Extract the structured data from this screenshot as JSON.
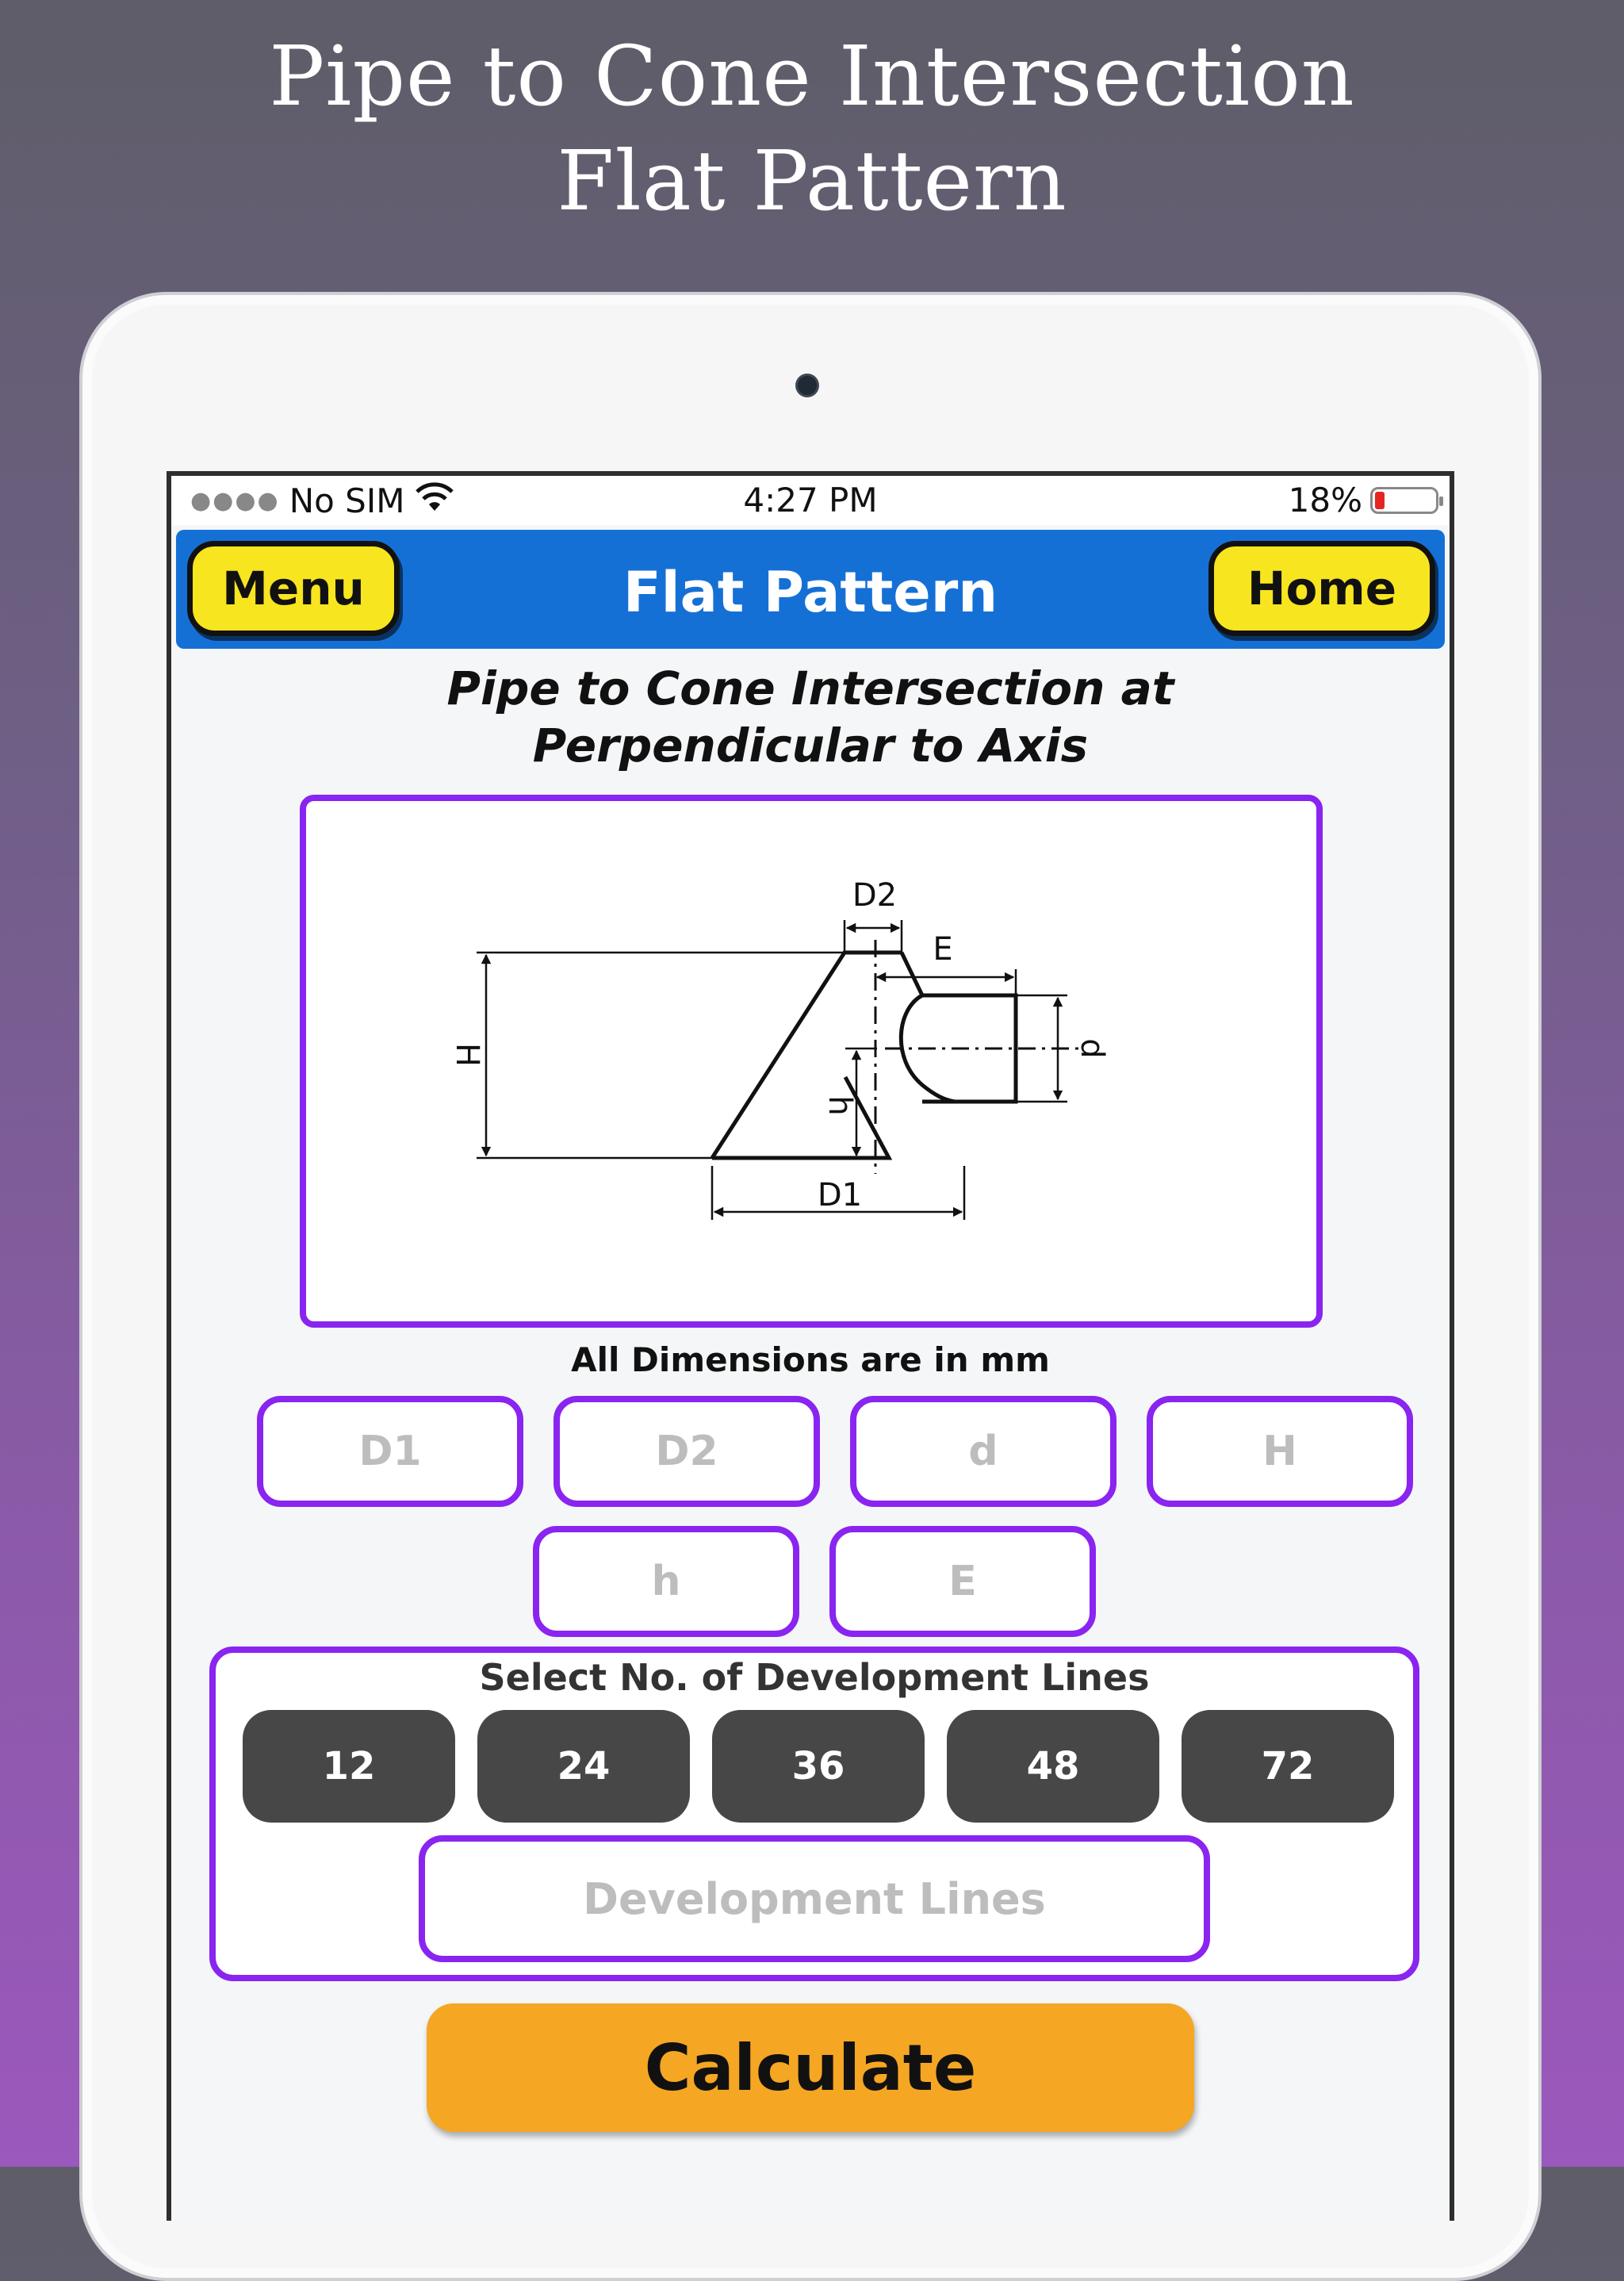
{
  "headline": {
    "line1": "Pipe to Cone Intersection",
    "line2": "Flat Pattern"
  },
  "status_bar": {
    "carrier": "No SIM",
    "time": "4:27 PM",
    "battery": "18%"
  },
  "nav": {
    "title": "Flat Pattern",
    "menu_label": "Menu",
    "home_label": "Home"
  },
  "page": {
    "title_line1": "Pipe to Cone Intersection at",
    "title_line2": "Perpendicular to Axis",
    "units_note": "All Dimensions are in mm"
  },
  "diagram": {
    "labels": {
      "D1": "D1",
      "D2": "D2",
      "E": "E",
      "H": "H",
      "h": "h",
      "d": "d"
    }
  },
  "inputs": {
    "D1": "D1",
    "D2": "D2",
    "d": "d",
    "H": "H",
    "h": "h",
    "E": "E"
  },
  "development": {
    "title": "Select No. of Development Lines",
    "options": [
      "12",
      "24",
      "36",
      "48",
      "72"
    ],
    "placeholder": "Development Lines"
  },
  "calculate_label": "Calculate",
  "colors": {
    "nav_blue": "#1570d6",
    "nav_button_yellow": "#f7e51f",
    "accent_purple": "#8a24f0",
    "option_gray": "#474747",
    "calculate_orange": "#f5a623"
  }
}
